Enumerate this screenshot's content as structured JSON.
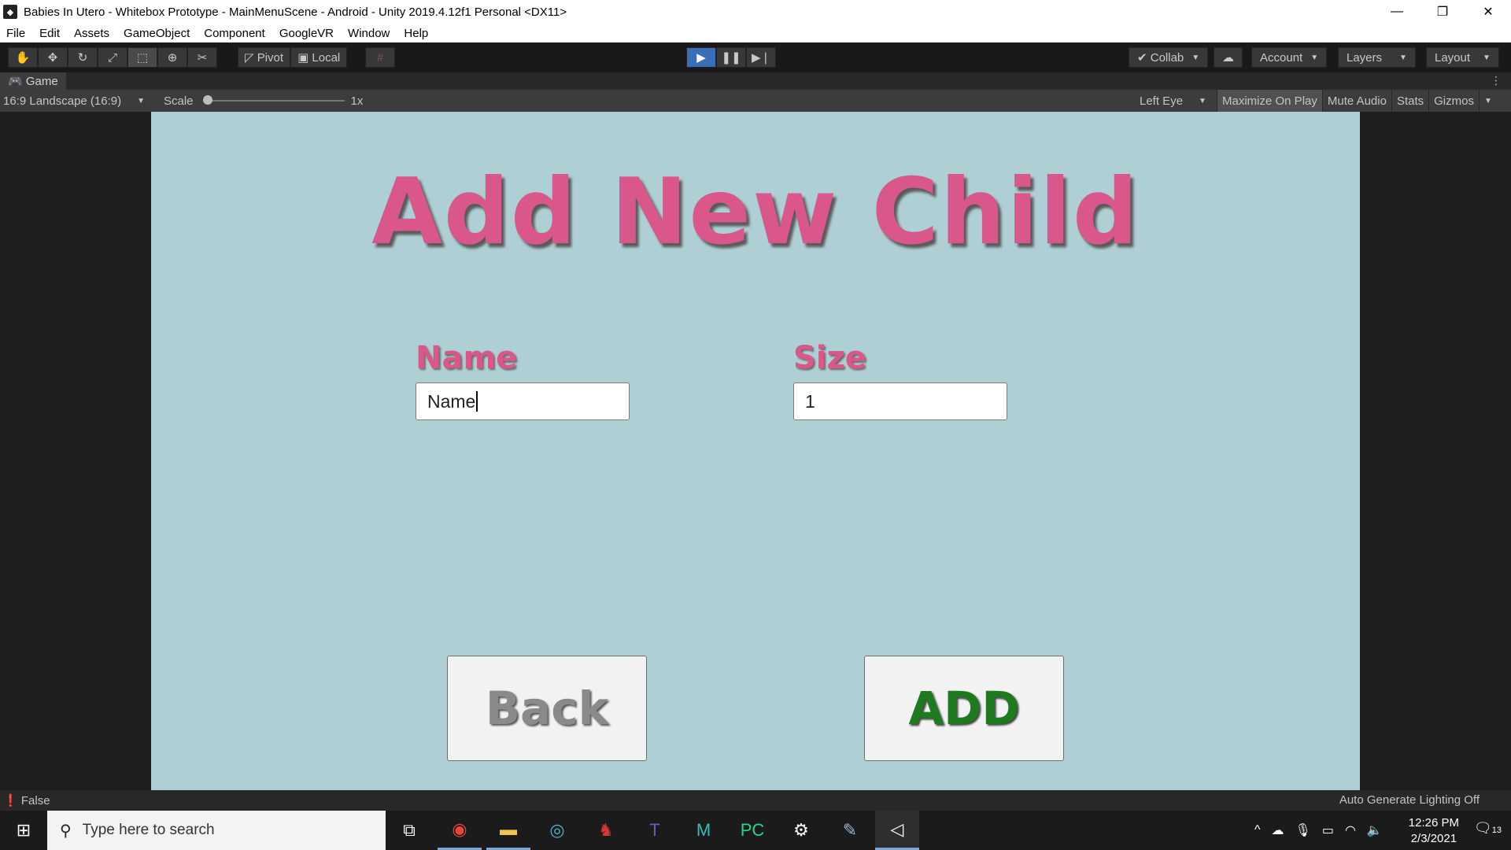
{
  "window": {
    "title": "Babies In Utero - Whitebox Prototype - MainMenuScene - Android - Unity 2019.4.12f1 Personal <DX11>",
    "minimize": "—",
    "maximize": "❐",
    "close": "✕"
  },
  "menu": [
    "File",
    "Edit",
    "Assets",
    "GameObject",
    "Component",
    "GoogleVR",
    "Window",
    "Help"
  ],
  "toolbar": {
    "pivot_label": "Pivot",
    "local_label": "Local",
    "collab_label": "Collab",
    "account_label": "Account",
    "layers_label": "Layers",
    "layout_label": "Layout"
  },
  "game_tab": {
    "label": "Game",
    "aspect": "16:9 Landscape (16:9)",
    "scale_label": "Scale",
    "scale_value": "1x",
    "eye": "Left Eye",
    "maximize_on_play": "Maximize On Play",
    "mute_audio": "Mute Audio",
    "stats": "Stats",
    "gizmos": "Gizmos"
  },
  "scene": {
    "heading": "Add New Child",
    "name_label": "Name",
    "name_value": "Name",
    "size_label": "Size",
    "size_value": "1",
    "back_button": "Back",
    "add_button": "ADD",
    "colors": {
      "background": "#aed0d5",
      "title_pink": "#d9578a",
      "add_green": "#1e7a1e"
    }
  },
  "status": {
    "message": "False",
    "lighting": "Auto Generate Lighting Off"
  },
  "taskbar": {
    "search_placeholder": "Type here to search",
    "time": "12:26 PM",
    "date": "2/3/2021",
    "notification_count": "13"
  }
}
